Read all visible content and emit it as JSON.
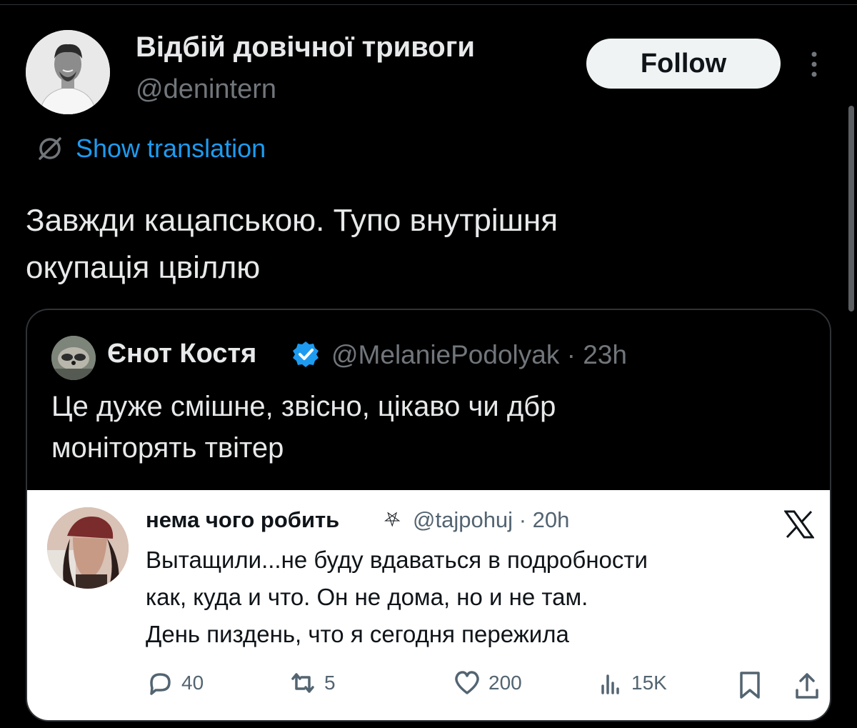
{
  "author": {
    "display_name": "Відбій довічної тривоги",
    "handle": "@denintern",
    "follow_label": "Follow"
  },
  "translate": {
    "label": "Show translation"
  },
  "tweet": {
    "line1": "Завжди кацапською. Тупо внутрішня",
    "line2": "окупація цвіллю"
  },
  "quote": {
    "display_name": "Єнот Костя",
    "handle": "@MelaniePodolyak",
    "separator": "·",
    "time": "23h",
    "line1": "Це дуже смішне, звісно, цікаво чи дбр",
    "line2": "моніторять твітер"
  },
  "embedded": {
    "display_name": "нема чого робить",
    "name_symbol": "⛧",
    "handle": "@tajpohuj",
    "separator": "·",
    "time": "20h",
    "line1": "Вытащили...не буду вдаваться в подробности",
    "line2": "как, куда и что. Он не дома, но и не там.",
    "line3": "День пиздень, что я сегодня пережила",
    "replies": "40",
    "reposts": "5",
    "likes": "200",
    "views": "15K"
  },
  "colors": {
    "background": "#000000",
    "text": "#e7e9ea",
    "muted": "#71767b",
    "accent": "#1d9bf0",
    "embed_background": "#ffffff"
  },
  "icons": [
    "more-icon",
    "translate-icon",
    "verified-icon",
    "x-logo-icon",
    "reply-icon",
    "repost-icon",
    "like-icon",
    "views-icon",
    "bookmark-icon",
    "share-icon"
  ]
}
